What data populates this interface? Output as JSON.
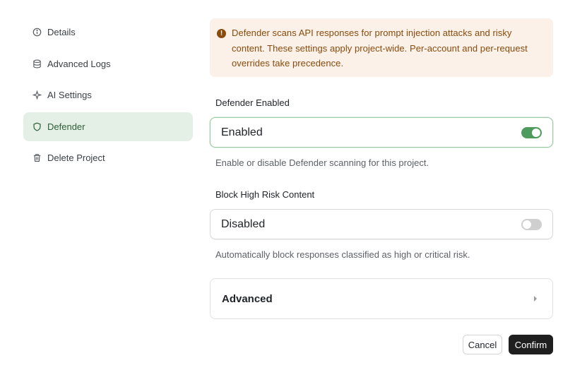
{
  "sidebar": {
    "items": [
      {
        "label": "Details",
        "icon": "info-icon"
      },
      {
        "label": "Advanced Logs",
        "icon": "database-icon"
      },
      {
        "label": "AI Settings",
        "icon": "sparkle-icon"
      },
      {
        "label": "Defender",
        "icon": "shield-icon",
        "active": true
      },
      {
        "label": "Delete Project",
        "icon": "trash-icon"
      }
    ]
  },
  "notice": {
    "text": "Defender scans API responses for prompt injection attacks and risky content. These settings apply project-wide. Per-account and per-request overrides take precedence.",
    "icon": "warning-icon",
    "color": "#8a4a0b",
    "background": "#fbf1e8"
  },
  "defender_enabled": {
    "label": "Defender Enabled",
    "value": "Enabled",
    "toggle_on": true,
    "help": "Enable or disable Defender scanning for this project."
  },
  "block_high_risk": {
    "label": "Block High Risk Content",
    "value": "Disabled",
    "toggle_on": false,
    "help": "Automatically block responses classified as high or critical risk."
  },
  "advanced": {
    "label": "Advanced",
    "icon": "chevron-right-icon"
  },
  "actions": {
    "cancel_label": "Cancel",
    "confirm_label": "Confirm"
  },
  "colors": {
    "accent_green": "#4f9a5e",
    "active_nav_bg": "#e4f0e6",
    "confirm_bg": "#1f1f1f"
  }
}
